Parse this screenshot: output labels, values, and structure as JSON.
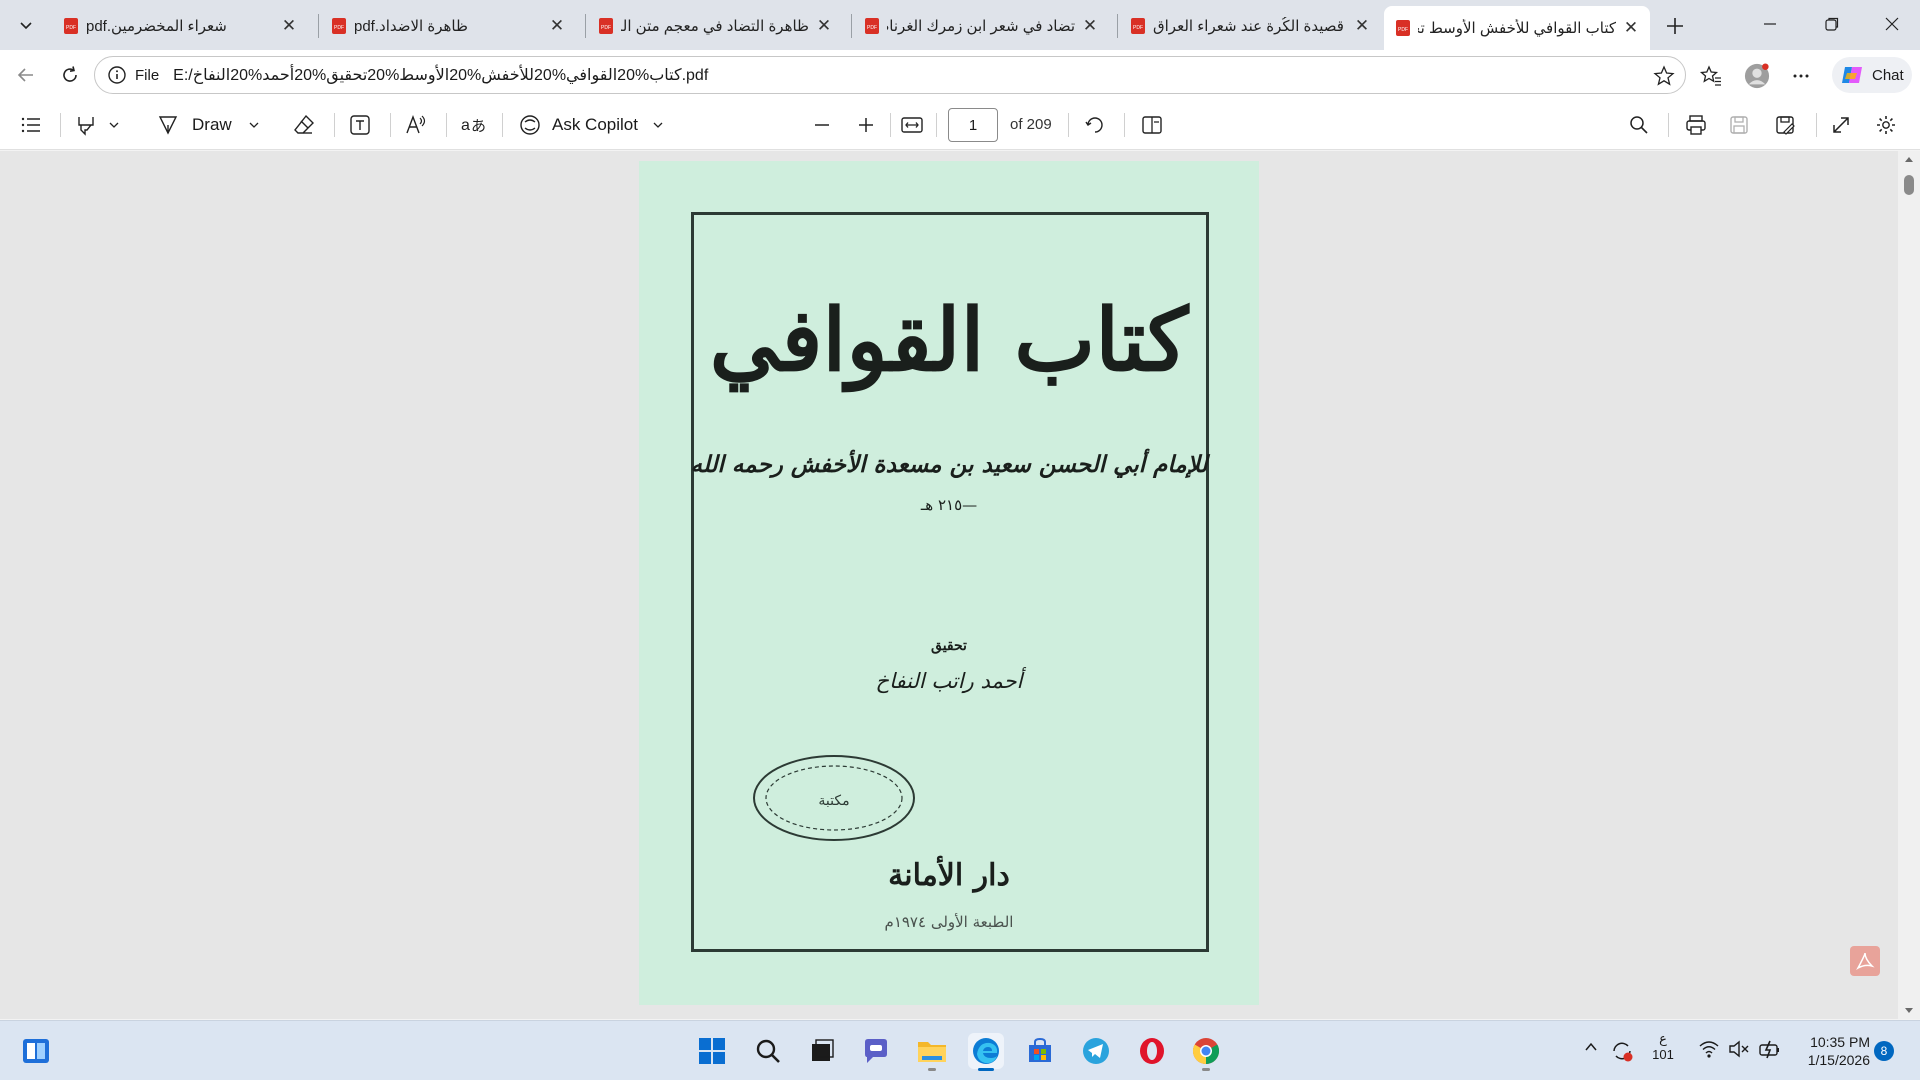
{
  "browser": {
    "tabs": [
      {
        "title": "شعراء المخضرمين.pdf",
        "active": false
      },
      {
        "title": "ظاهرة الاضداد.pdf",
        "active": false
      },
      {
        "title": "ظاهرة التضاد في معجم متن اللغة",
        "active": false
      },
      {
        "title": "تضاد في شعر ابن زمرك الغرناطي",
        "active": false
      },
      {
        "title": "قصيدة الكُرة عند شعراء العراق",
        "active": false
      },
      {
        "title": "كتاب القوافي للأخفش الأوسط تحقيق",
        "active": true
      }
    ],
    "address": {
      "scheme": "File",
      "url": "E:/كتاب%20القوافي%20للأخفش%20الأوسط%20تحقيق%20أحمد%20النفاخ.pdf"
    },
    "chat_label": "Chat"
  },
  "pdf_toolbar": {
    "draw_label": "Draw",
    "ask_copilot_label": "Ask Copilot",
    "page_number": "1",
    "page_count": "of 209"
  },
  "document": {
    "title": "كتاب القوافي",
    "author": "للإمام أبي الحسن سعيد بن مسعدة الأخفش رحمه الله",
    "date": "—٢١٥ هـ",
    "tahqiq_label": "تحقيق",
    "editor": "أحمد راتب النفاخ",
    "stamp_text": "مكتبة",
    "publisher": "دار الأمانة",
    "edition": "الطبعة الأولى ١٩٧٤م"
  },
  "taskbar": {
    "tray_lang": "ع",
    "tray_lang_sub": "101",
    "time": "10:35 PM",
    "date": "1/15/2026",
    "notifications": "8"
  },
  "colors": {
    "page_bg": "#cfeedd",
    "accent": "#0067c0"
  }
}
